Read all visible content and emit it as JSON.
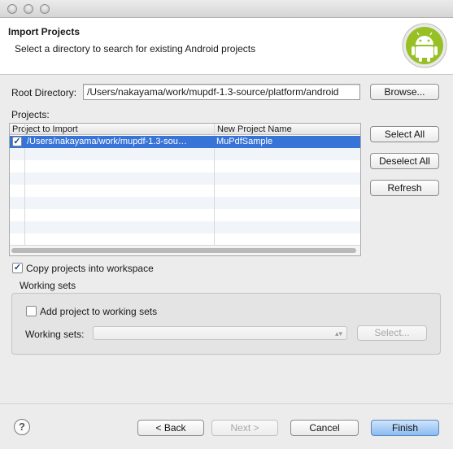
{
  "window": {
    "traffic_lights": [
      "close",
      "minimize",
      "zoom"
    ]
  },
  "header": {
    "title": "Import Projects",
    "description": "Select a directory to search for existing Android projects",
    "logo_icon": "android-logo-icon"
  },
  "root_directory": {
    "label": "Root Directory:",
    "value": "/Users/nakayama/work/mupdf-1.3-source/platform/android",
    "browse_label": "Browse..."
  },
  "projects": {
    "label": "Projects:",
    "columns": [
      "Project to Import",
      "New Project Name"
    ],
    "rows": [
      {
        "checked": true,
        "path": "/Users/nakayama/work/mupdf-1.3-sou…",
        "name": "MuPdfSample"
      }
    ],
    "select_all_label": "Select All",
    "deselect_all_label": "Deselect All",
    "refresh_label": "Refresh"
  },
  "copy_into_workspace": {
    "label": "Copy projects into workspace",
    "checked": true
  },
  "working_sets": {
    "group_label": "Working sets",
    "add_label": "Add project to working sets",
    "add_checked": false,
    "select_label": "Working sets:",
    "selected_value": "",
    "select_button_label": "Select..."
  },
  "footer": {
    "help_label": "?",
    "back_label": "< Back",
    "next_label": "Next >",
    "cancel_label": "Cancel",
    "finish_label": "Finish"
  },
  "colors": {
    "selection": "#3874d8",
    "primary_button": "#8bbcf2",
    "android_green": "#97c024"
  }
}
